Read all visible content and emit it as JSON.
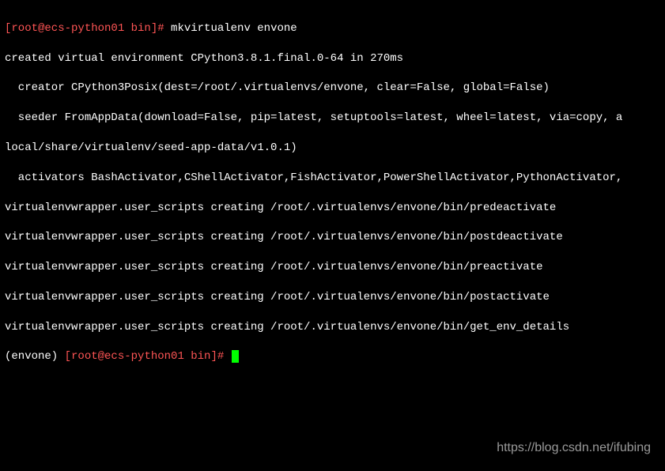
{
  "terminal": {
    "prompt1": "[root@ecs-python01 bin]# ",
    "command1": "mkvirtualenv envone",
    "output_lines": [
      "created virtual environment CPython3.8.1.final.0-64 in 270ms",
      "  creator CPython3Posix(dest=/root/.virtualenvs/envone, clear=False, global=False)",
      "  seeder FromAppData(download=False, pip=latest, setuptools=latest, wheel=latest, via=copy, a",
      "local/share/virtualenv/seed-app-data/v1.0.1)",
      "  activators BashActivator,CShellActivator,FishActivator,PowerShellActivator,PythonActivator,",
      "virtualenvwrapper.user_scripts creating /root/.virtualenvs/envone/bin/predeactivate",
      "virtualenvwrapper.user_scripts creating /root/.virtualenvs/envone/bin/postdeactivate",
      "virtualenvwrapper.user_scripts creating /root/.virtualenvs/envone/bin/preactivate",
      "virtualenvwrapper.user_scripts creating /root/.virtualenvs/envone/bin/postactivate",
      "virtualenvwrapper.user_scripts creating /root/.virtualenvs/envone/bin/get_env_details"
    ],
    "prompt2_env": "(envone) ",
    "prompt2": "[root@ecs-python01 bin]# "
  },
  "watermark": "https://blog.csdn.net/ifubing"
}
